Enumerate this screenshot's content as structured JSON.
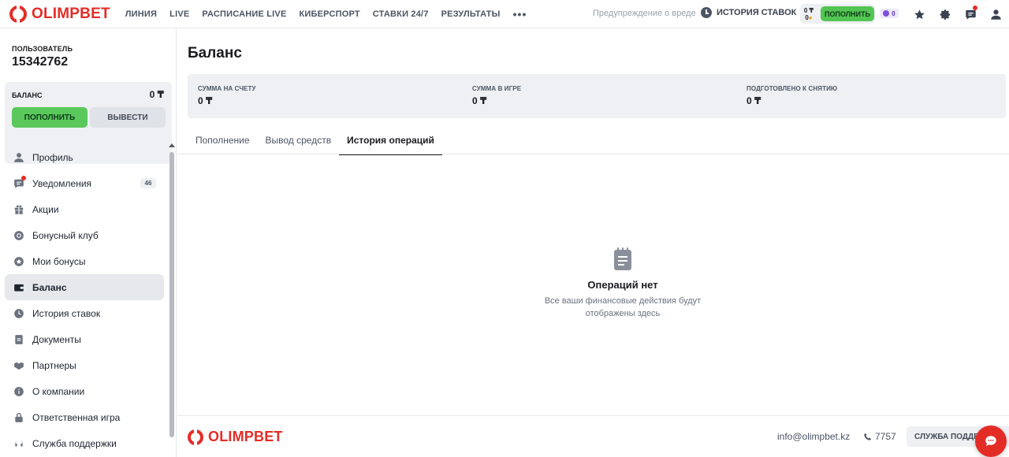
{
  "header": {
    "brand": "OLIMPBET",
    "nav": [
      "ЛИНИЯ",
      "LIVE",
      "РАСПИСАНИЕ LIVE",
      "КИБЕРСПОРТ",
      "СТАВКИ 24/7",
      "РЕЗУЛЬТАТЫ"
    ],
    "more": "•••",
    "warning_link": "Предупреждение о вреде",
    "history_link": "ИСТОРИЯ СТАВОК",
    "wallet_balance": "0 ₸",
    "wallet_bonus": "0",
    "topup_label": "ПОПОЛНИТЬ",
    "keys_count": "0",
    "icons": [
      "star-icon",
      "gear-icon",
      "chat-icon",
      "user-icon"
    ]
  },
  "sidebar": {
    "user_label": "ПОЛЬЗОВАТЕЛЬ",
    "user_id": "15342762",
    "balance_label": "БАЛАНС",
    "balance_value": "0 ₸",
    "topup_label": "ПОПОЛНИТЬ",
    "withdraw_label": "ВЫВЕСТИ",
    "items": [
      {
        "label": "Профиль",
        "icon": "user-icon"
      },
      {
        "label": "Уведомления",
        "icon": "chat-icon",
        "count": "46"
      },
      {
        "label": "Акции",
        "icon": "gift-icon"
      },
      {
        "label": "Бонусный клуб",
        "icon": "club-icon"
      },
      {
        "label": "Мои бонусы",
        "icon": "star-circle-icon"
      },
      {
        "label": "Баланс",
        "icon": "wallet-icon",
        "active": true
      },
      {
        "label": "История ставок",
        "icon": "clock-icon"
      },
      {
        "label": "Документы",
        "icon": "document-icon"
      },
      {
        "label": "Партнеры",
        "icon": "handshake-icon"
      },
      {
        "label": "О компании",
        "icon": "info-icon"
      },
      {
        "label": "Ответственная игра",
        "icon": "lock-icon"
      },
      {
        "label": "Служба поддержки",
        "icon": "headset-icon"
      }
    ]
  },
  "main": {
    "title": "Баланс",
    "sums": [
      {
        "label": "СУММА НА СЧЕТУ",
        "value": "0 ₸"
      },
      {
        "label": "СУММА В ИГРЕ",
        "value": "0 ₸"
      },
      {
        "label": "ПОДГОТОВЛЕНО К СНЯТИЮ",
        "value": "0 ₸"
      }
    ],
    "tabs": [
      "Пополнение",
      "Вывод средств",
      "История операций"
    ],
    "active_tab": "История операций",
    "empty_title": "Операций нет",
    "empty_sub_1": "Все ваши финансовые действия будут",
    "empty_sub_2": "отображены здесь"
  },
  "footer": {
    "brand": "OLIMPBET",
    "email": "info@olimpbet.kz",
    "phone": "7757",
    "support_label": "СЛУЖБА ПОДДЕРЖКИ"
  },
  "colors": {
    "brand": "#e42c27",
    "accent_green": "#5ac85b",
    "panel": "#eef0f3"
  }
}
